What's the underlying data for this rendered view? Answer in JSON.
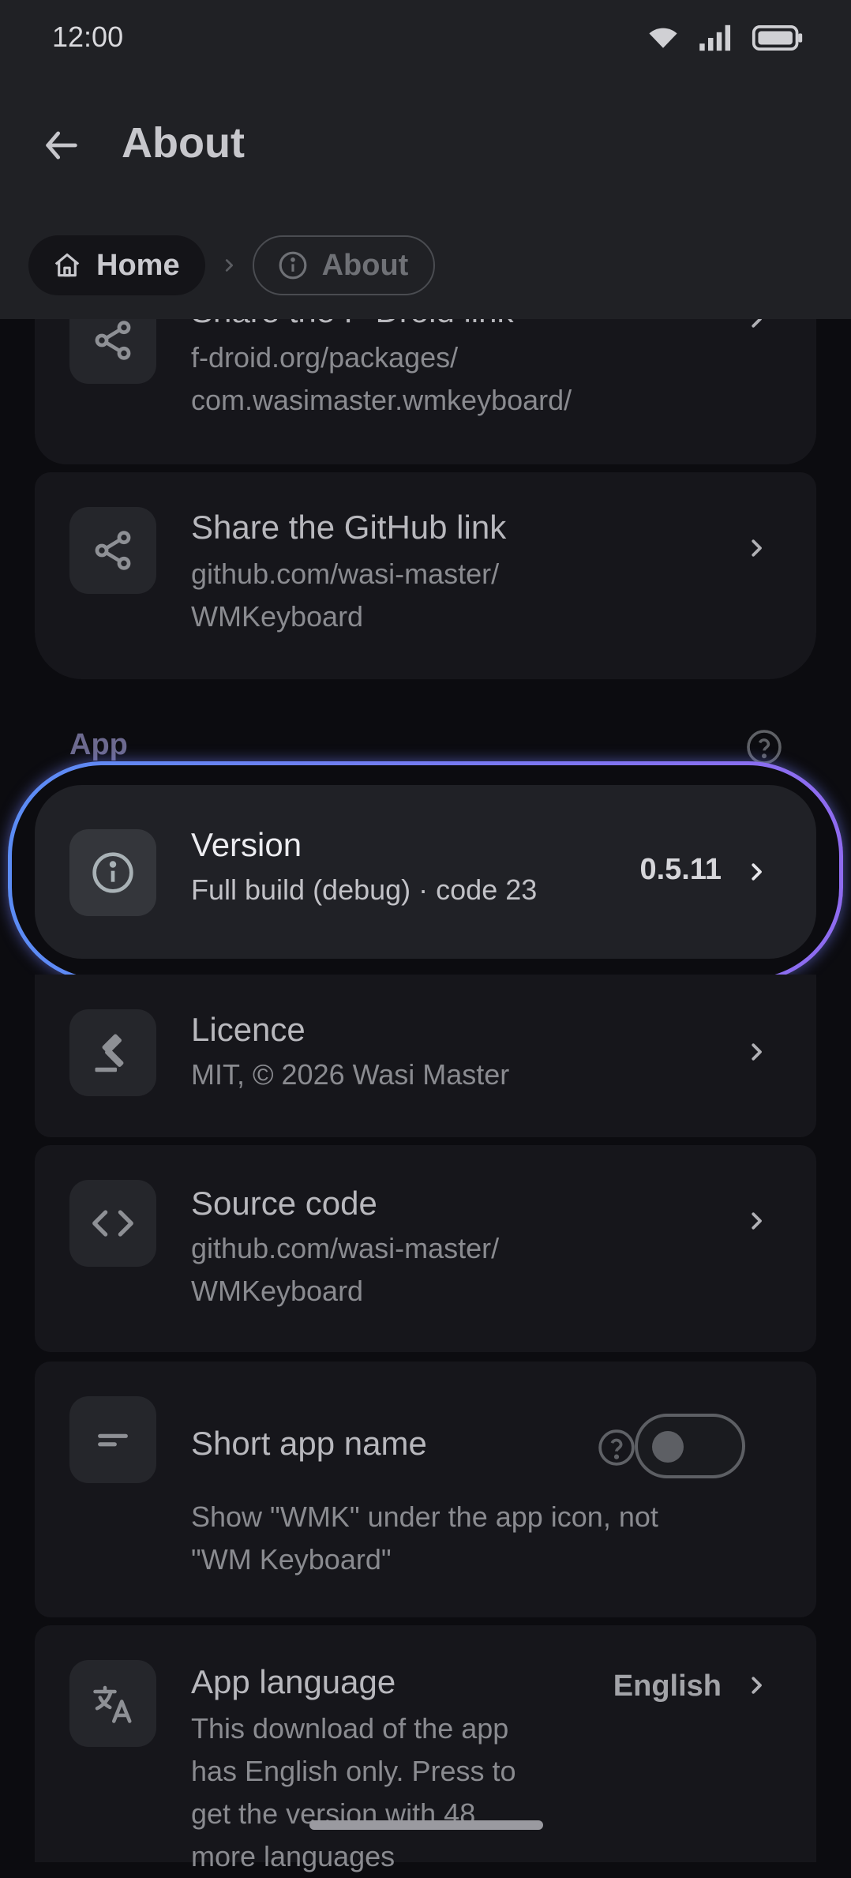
{
  "status_bar": {
    "time": "12:00"
  },
  "app_bar": {
    "title": "About"
  },
  "breadcrumb": {
    "home": "Home",
    "current": "About"
  },
  "links": [
    {
      "title": "Share the F-Droid link",
      "subtitle_line1": "f-droid.org/packages/",
      "subtitle_line2": "com.wasimaster.wmkeyboard/"
    },
    {
      "title": "Share the GitHub link",
      "subtitle_line1": "github.com/wasi-master/",
      "subtitle_line2": "WMKeyboard"
    }
  ],
  "section": {
    "label": "App"
  },
  "version": {
    "title": "Version",
    "subtitle": "Full build (debug) · code 23",
    "value": "0.5.11"
  },
  "licence": {
    "title": "Licence",
    "subtitle": "MIT, © 2026 Wasi Master"
  },
  "source": {
    "title": "Source code",
    "subtitle_line1": "github.com/wasi-master/",
    "subtitle_line2": "WMKeyboard"
  },
  "short_name": {
    "title": "Short app name",
    "description_line1": "Show \"WMK\" under the app icon, not",
    "description_line2": "\"WM Keyboard\"",
    "enabled": false
  },
  "language": {
    "title": "App language",
    "value": "English",
    "description_line1": "This download of the app",
    "description_line2": "has English only. Press to",
    "description_line3": "get the version with 48",
    "description_line4": "more languages"
  },
  "colors": {
    "accent_start": "#5b8cf5",
    "accent_end": "#8f6bf0",
    "background": "#0c0c10",
    "card": "#16161b"
  }
}
